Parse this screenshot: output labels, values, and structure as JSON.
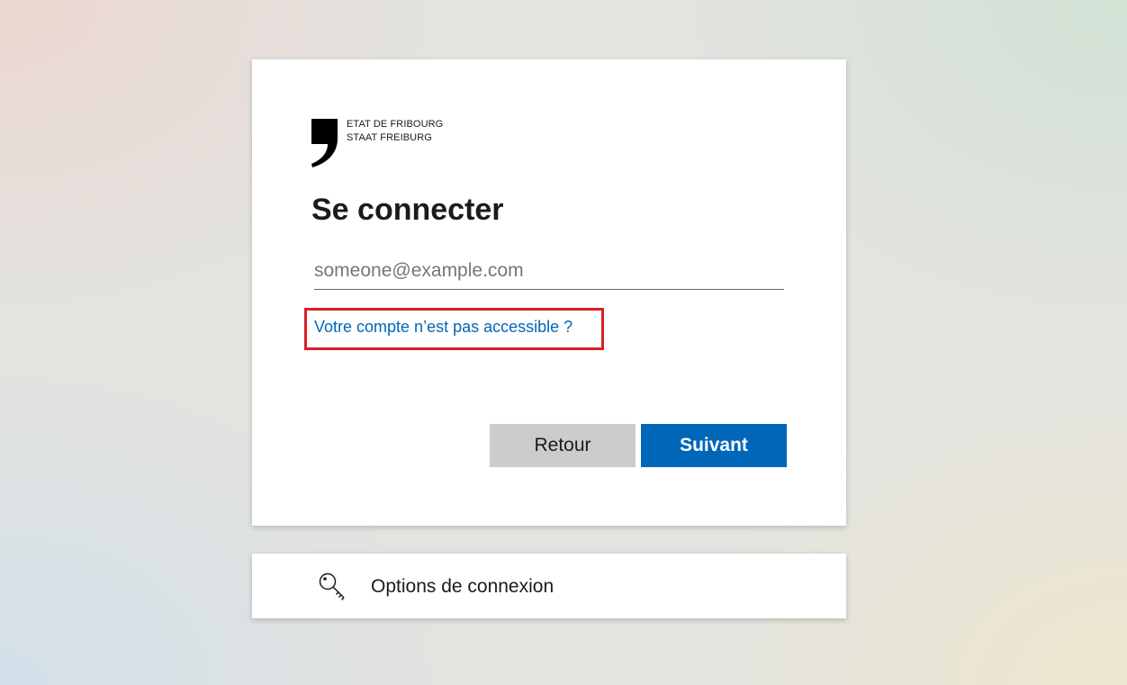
{
  "logo": {
    "line1": "ETAT DE FRIBOURG",
    "line2": "STAAT FREIBURG"
  },
  "signin": {
    "title": "Se connecter",
    "email": {
      "value": "",
      "placeholder": "someone@example.com"
    },
    "account_link": "Votre compte n’est pas accessible ?",
    "back_label": "Retour",
    "next_label": "Suivant"
  },
  "options": {
    "label": "Options de connexion",
    "icon": "key-icon"
  },
  "colors": {
    "accent": "#0067b8",
    "highlight": "#d8202c",
    "back_button": "#cccccc"
  }
}
